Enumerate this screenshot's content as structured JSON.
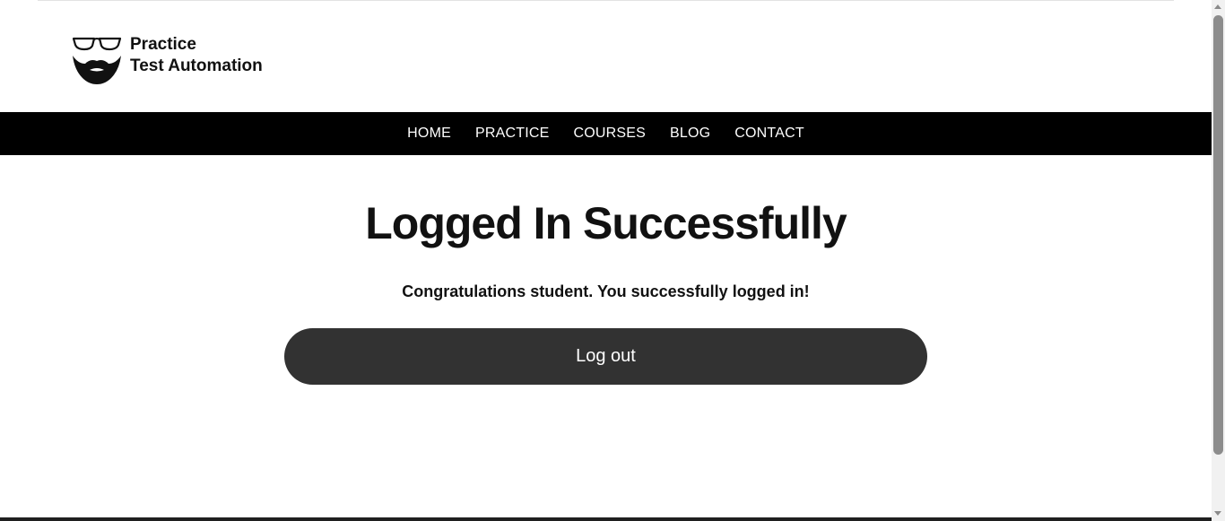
{
  "brand": {
    "line1": "Practice",
    "line2": "Test Automation",
    "logo_icon": "glasses-beard-logo-icon"
  },
  "nav": {
    "items": [
      {
        "label": "HOME"
      },
      {
        "label": "PRACTICE"
      },
      {
        "label": "COURSES"
      },
      {
        "label": "BLOG"
      },
      {
        "label": "CONTACT"
      }
    ]
  },
  "main": {
    "title": "Logged In Successfully",
    "message": "Congratulations student. You successfully logged in!",
    "logout_label": "Log out"
  },
  "colors": {
    "navbar_bg": "#000000",
    "button_bg": "#323232",
    "text": "#111111"
  }
}
